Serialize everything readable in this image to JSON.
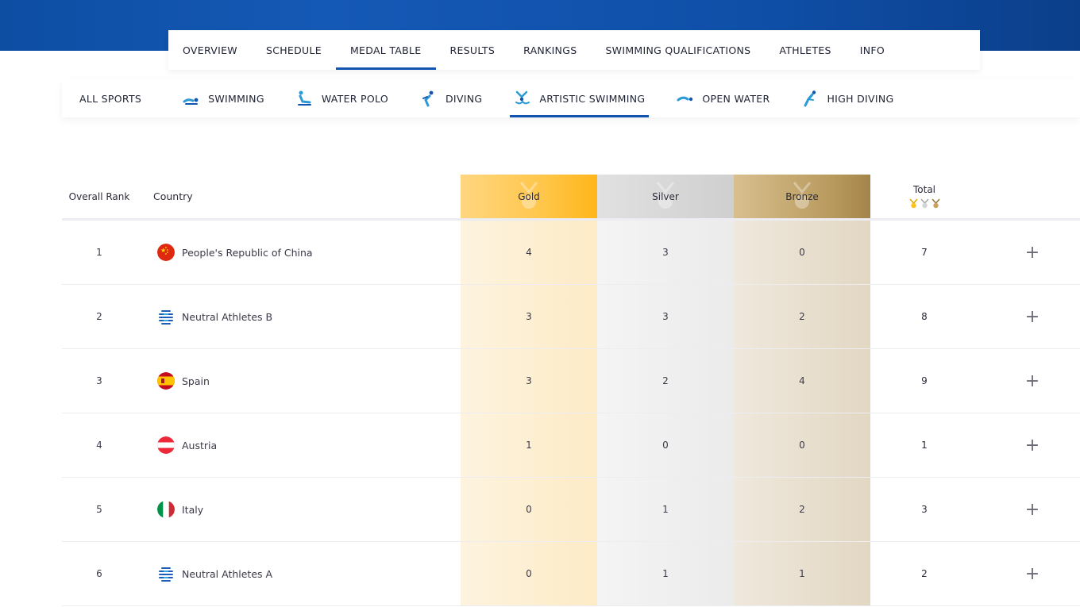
{
  "main_nav": [
    {
      "label": "OVERVIEW"
    },
    {
      "label": "SCHEDULE"
    },
    {
      "label": "MEDAL TABLE",
      "active": true
    },
    {
      "label": "RESULTS"
    },
    {
      "label": "RANKINGS"
    },
    {
      "label": "SWIMMING QUALIFICATIONS"
    },
    {
      "label": "ATHLETES"
    },
    {
      "label": "INFO"
    }
  ],
  "sport_nav": [
    {
      "label": "ALL SPORTS",
      "icon": ""
    },
    {
      "label": "SWIMMING",
      "icon": "swimming-icon"
    },
    {
      "label": "WATER POLO",
      "icon": "water-polo-icon"
    },
    {
      "label": "DIVING",
      "icon": "diving-icon"
    },
    {
      "label": "ARTISTIC SWIMMING",
      "icon": "artistic-swimming-icon",
      "active": true
    },
    {
      "label": "OPEN WATER",
      "icon": "open-water-icon"
    },
    {
      "label": "HIGH DIVING",
      "icon": "high-diving-icon"
    }
  ],
  "table": {
    "headers": {
      "rank": "Overall Rank",
      "country": "Country",
      "gold": "Gold",
      "silver": "Silver",
      "bronze": "Bronze",
      "total": "Total"
    },
    "colors": {
      "accent": "#1255b0",
      "gold": "#ffc64a",
      "silver": "#cfcfcf",
      "bronze": "#b99b5f"
    },
    "rows": [
      {
        "rank": "1",
        "country": "People's Republic of China",
        "flag": "china-flag-icon",
        "gold": "4",
        "silver": "3",
        "bronze": "0",
        "total": "7"
      },
      {
        "rank": "2",
        "country": "Neutral Athletes B",
        "flag": "neutral-flag-icon",
        "gold": "3",
        "silver": "3",
        "bronze": "2",
        "total": "8"
      },
      {
        "rank": "3",
        "country": "Spain",
        "flag": "spain-flag-icon",
        "gold": "3",
        "silver": "2",
        "bronze": "4",
        "total": "9"
      },
      {
        "rank": "4",
        "country": "Austria",
        "flag": "austria-flag-icon",
        "gold": "1",
        "silver": "0",
        "bronze": "0",
        "total": "1"
      },
      {
        "rank": "5",
        "country": "Italy",
        "flag": "italy-flag-icon",
        "gold": "0",
        "silver": "1",
        "bronze": "2",
        "total": "3"
      },
      {
        "rank": "6",
        "country": "Neutral Athletes A",
        "flag": "neutral-flag-icon",
        "gold": "0",
        "silver": "1",
        "bronze": "1",
        "total": "2"
      }
    ],
    "expand_symbol": "+"
  }
}
